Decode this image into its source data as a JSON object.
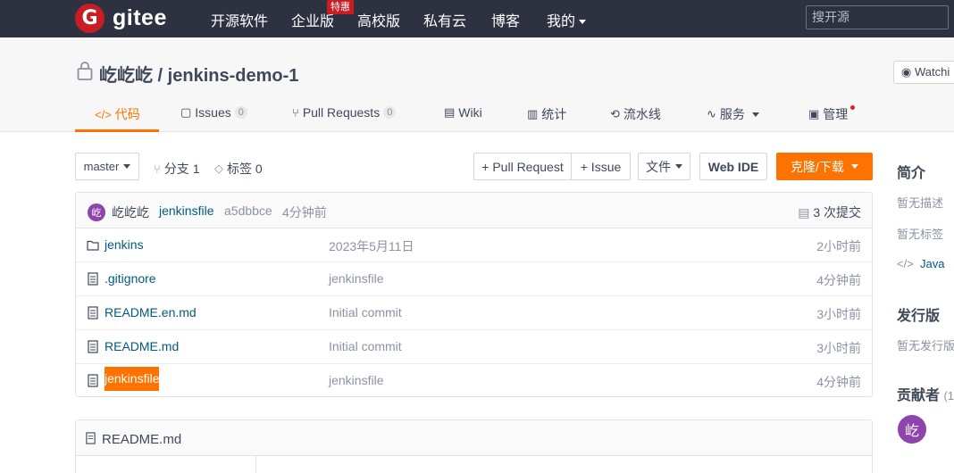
{
  "nav": {
    "logo_mark": "G",
    "logo_text": "gitee",
    "items": [
      "开源软件",
      "企业版",
      "高校版",
      "私有云",
      "博客",
      "我的"
    ],
    "badge": "特惠",
    "search_placeholder": "搜开源"
  },
  "repo": {
    "title": "屹屹屹 / jenkins-demo-1",
    "watch_label": "Watchi"
  },
  "tabs": [
    {
      "label": "代码",
      "icon": "</>"
    },
    {
      "label": "Issues",
      "count": "0",
      "icon": "▢"
    },
    {
      "label": "Pull Requests",
      "count": "0",
      "icon": "⑂"
    },
    {
      "label": "Wiki",
      "icon": "▤"
    },
    {
      "label": "统计",
      "icon": "▥"
    },
    {
      "label": "流水线",
      "icon": "⟲"
    },
    {
      "label": "服务",
      "icon": "∿"
    },
    {
      "label": "管理",
      "icon": "▣"
    }
  ],
  "toolbar": {
    "branch": "master",
    "branches": "分支 1",
    "tags": "标签 0",
    "pull_request": "+ Pull Request",
    "issue": "+ Issue",
    "file": "文件",
    "web_ide": "Web IDE",
    "clone": "克隆/下载"
  },
  "commit": {
    "avatar": "屹",
    "author": "屹屹屹",
    "message": "jenkinsfile",
    "hash": "a5dbbce",
    "time": "4分钟前",
    "count": "3 次提交"
  },
  "files": [
    {
      "type": "folder",
      "name": "jenkins",
      "message": "2023年5月11日",
      "time": "2小时前"
    },
    {
      "type": "file",
      "name": ".gitignore",
      "message": "jenkinsfile",
      "time": "4分钟前"
    },
    {
      "type": "file",
      "name": "README.en.md",
      "message": "Initial commit",
      "time": "3小时前"
    },
    {
      "type": "file",
      "name": "README.md",
      "message": "Initial commit",
      "time": "3小时前"
    },
    {
      "type": "file",
      "name": "jenkinsfile",
      "message": "jenkinsfile",
      "time": "4分钟前"
    }
  ],
  "readme": {
    "title": "README.md"
  },
  "sidebar": {
    "intro_heading": "简介",
    "no_desc": "暂无描述",
    "no_tags": "暂无标签",
    "language": "Java",
    "release_heading": "发行版",
    "no_release": "暂无发行版",
    "contributors_heading": "贡献者",
    "contributors_count": "(1",
    "contributor_avatar": "屹"
  },
  "colors": {
    "accent": "#fe7300",
    "nav_bg": "#2e3140",
    "brand_red": "#c71d23",
    "link": "#005980"
  }
}
